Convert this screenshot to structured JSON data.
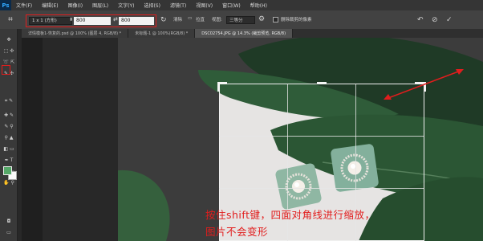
{
  "app": {
    "logo": "Ps"
  },
  "menu": [
    "文件(F)",
    "编辑(E)",
    "图像(I)",
    "图层(L)",
    "文字(Y)",
    "选择(S)",
    "滤镜(T)",
    "视图(V)",
    "窗口(W)",
    "帮助(H)"
  ],
  "options": {
    "ratio": "1 x 1 (方形)",
    "width": "800",
    "height": "800",
    "swap_icon": "⇄",
    "clear_label": "清除",
    "straighten_label": "拉直",
    "view_label": "视图:",
    "view_value": "三等分",
    "delete_label": "删除裁剪的像素"
  },
  "tabs": [
    {
      "label": "详情模板1-恢复的.psd @ 100% (图层 4, RGB/8) *",
      "active": false
    },
    {
      "label": "未标题-1 @ 100%(RGB/8) *",
      "active": false
    },
    {
      "label": "DSC02754.JPG @ 14.3% (裁剪预览, RGB/8)",
      "active": true
    }
  ],
  "caption": {
    "line1": "按住shift键，四面对角线进行缩放，",
    "line2": "图片不会变形"
  },
  "colors": {
    "accent_red": "#e01d1d",
    "foreground": "#55a868",
    "background": "#fafafa"
  },
  "icons": [
    "crop-icon",
    "swap-icon",
    "reset-icon",
    "cancel-icon",
    "commit-icon",
    "gear-icon",
    "arrow-icon"
  ]
}
